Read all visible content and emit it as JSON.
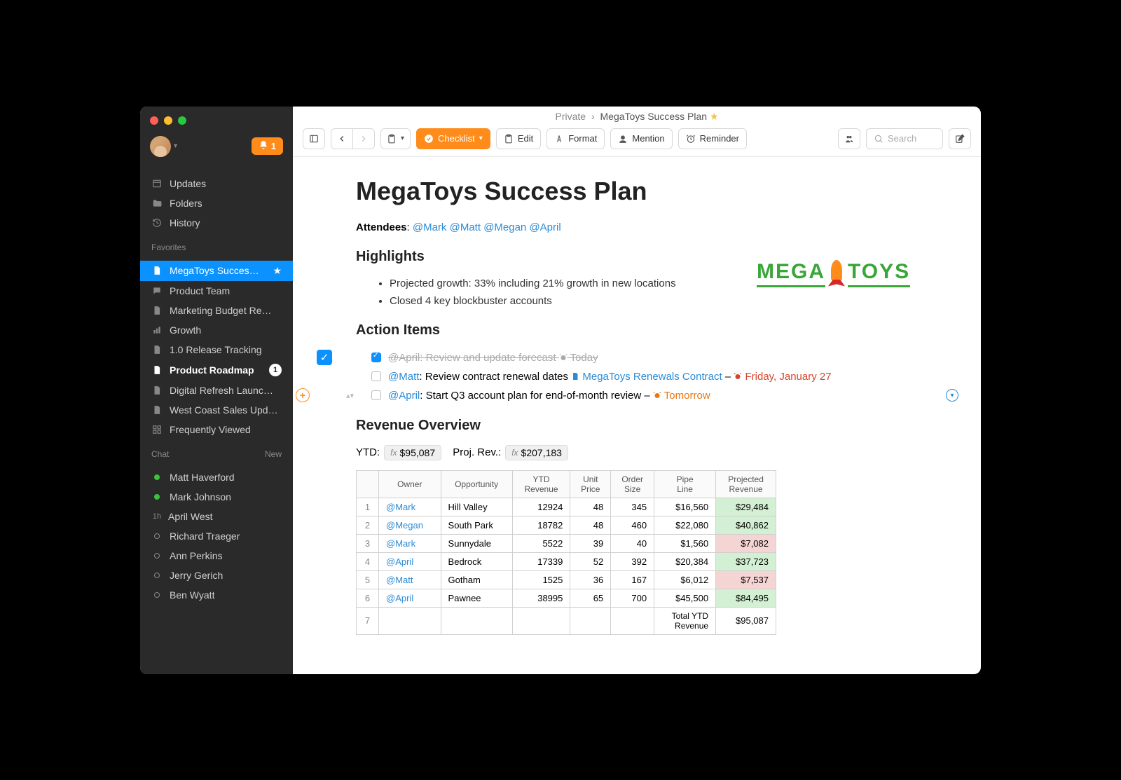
{
  "breadcrumb": {
    "root": "Private",
    "doc": "MegaToys Success Plan"
  },
  "notifications": {
    "count": "1"
  },
  "sidebar": {
    "nav": [
      {
        "label": "Updates",
        "icon": "updates"
      },
      {
        "label": "Folders",
        "icon": "folder"
      },
      {
        "label": "History",
        "icon": "history"
      }
    ],
    "favorites_title": "Favorites",
    "favorites": [
      {
        "label": "MegaToys Succes…",
        "icon": "doc",
        "active": true,
        "star": true
      },
      {
        "label": "Product Team",
        "icon": "chat"
      },
      {
        "label": "Marketing Budget Re…",
        "icon": "doc"
      },
      {
        "label": "Growth",
        "icon": "bar"
      },
      {
        "label": "1.0 Release Tracking",
        "icon": "doc"
      },
      {
        "label": "Product Roadmap",
        "icon": "doc",
        "bold": true,
        "count": "1"
      },
      {
        "label": "Digital Refresh Launc…",
        "icon": "doc"
      },
      {
        "label": "West Coast Sales Upd…",
        "icon": "doc"
      },
      {
        "label": "Frequently Viewed",
        "icon": "grid"
      }
    ],
    "chat_title": "Chat",
    "chat_new": "New",
    "chats": [
      {
        "label": "Matt Haverford",
        "presence": "online"
      },
      {
        "label": "Mark Johnson",
        "presence": "online"
      },
      {
        "label": "April West",
        "time": "1h"
      },
      {
        "label": "Richard Traeger",
        "presence": "away"
      },
      {
        "label": "Ann Perkins",
        "presence": "away"
      },
      {
        "label": "Jerry Gerich",
        "presence": "away"
      },
      {
        "label": "Ben Wyatt",
        "presence": "away"
      }
    ]
  },
  "toolbar": {
    "checklist": "Checklist",
    "edit": "Edit",
    "format": "Format",
    "mention": "Mention",
    "reminder": "Reminder",
    "search_placeholder": "Search"
  },
  "doc": {
    "title": "MegaToys Success Plan",
    "attendees_label": "Attendees",
    "attendees": [
      "@Mark",
      "@Matt",
      "@Megan",
      "@April"
    ],
    "logo_left": "MEGA",
    "logo_right": "TOYS",
    "highlights_title": "Highlights",
    "highlights": [
      "Projected growth: 33% including 21% growth in new locations",
      "Closed 4 key blockbuster accounts"
    ],
    "action_title": "Action Items",
    "actions": [
      {
        "checked": true,
        "mention": "@April",
        "text": "Review and update forecast",
        "due": "Today",
        "due_class": ""
      },
      {
        "checked": false,
        "mention": "@Matt",
        "text": "Review contract renewal dates",
        "link": "MegaToys Renewals Contract",
        "sep": "–",
        "due": "Friday, January 27",
        "due_class": "red"
      },
      {
        "checked": false,
        "mention": "@April",
        "text": "Start Q3 account plan for end-of-month review",
        "sep": "–",
        "due": "Tomorrow",
        "due_class": "orange"
      }
    ],
    "revenue_title": "Revenue Overview",
    "ytd_label": "YTD:",
    "ytd_value": "$95,087",
    "proj_label": "Proj. Rev.:",
    "proj_value": "$207,183",
    "table": {
      "headers": [
        "",
        "Owner",
        "Opportunity",
        "YTD Revenue",
        "Unit Price",
        "Order Size",
        "Pipe Line",
        "Projected Revenue"
      ],
      "rows": [
        {
          "n": "1",
          "owner": "@Mark",
          "opp": "Hill Valley",
          "ytd": "12924",
          "price": "48",
          "order": "345",
          "pipe": "$16,560",
          "proj": "$29,484",
          "good": true
        },
        {
          "n": "2",
          "owner": "@Megan",
          "opp": "South Park",
          "ytd": "18782",
          "price": "48",
          "order": "460",
          "pipe": "$22,080",
          "proj": "$40,862",
          "good": true
        },
        {
          "n": "3",
          "owner": "@Mark",
          "opp": "Sunnydale",
          "ytd": "5522",
          "price": "39",
          "order": "40",
          "pipe": "$1,560",
          "proj": "$7,082",
          "good": false
        },
        {
          "n": "4",
          "owner": "@April",
          "opp": "Bedrock",
          "ytd": "17339",
          "price": "52",
          "order": "392",
          "pipe": "$20,384",
          "proj": "$37,723",
          "good": true
        },
        {
          "n": "5",
          "owner": "@Matt",
          "opp": "Gotham",
          "ytd": "1525",
          "price": "36",
          "order": "167",
          "pipe": "$6,012",
          "proj": "$7,537",
          "good": false
        },
        {
          "n": "6",
          "owner": "@April",
          "opp": "Pawnee",
          "ytd": "38995",
          "price": "65",
          "order": "700",
          "pipe": "$45,500",
          "proj": "$84,495",
          "good": true
        }
      ],
      "total_row": {
        "n": "7",
        "label": "Total YTD Revenue",
        "value": "$95,087"
      }
    }
  }
}
